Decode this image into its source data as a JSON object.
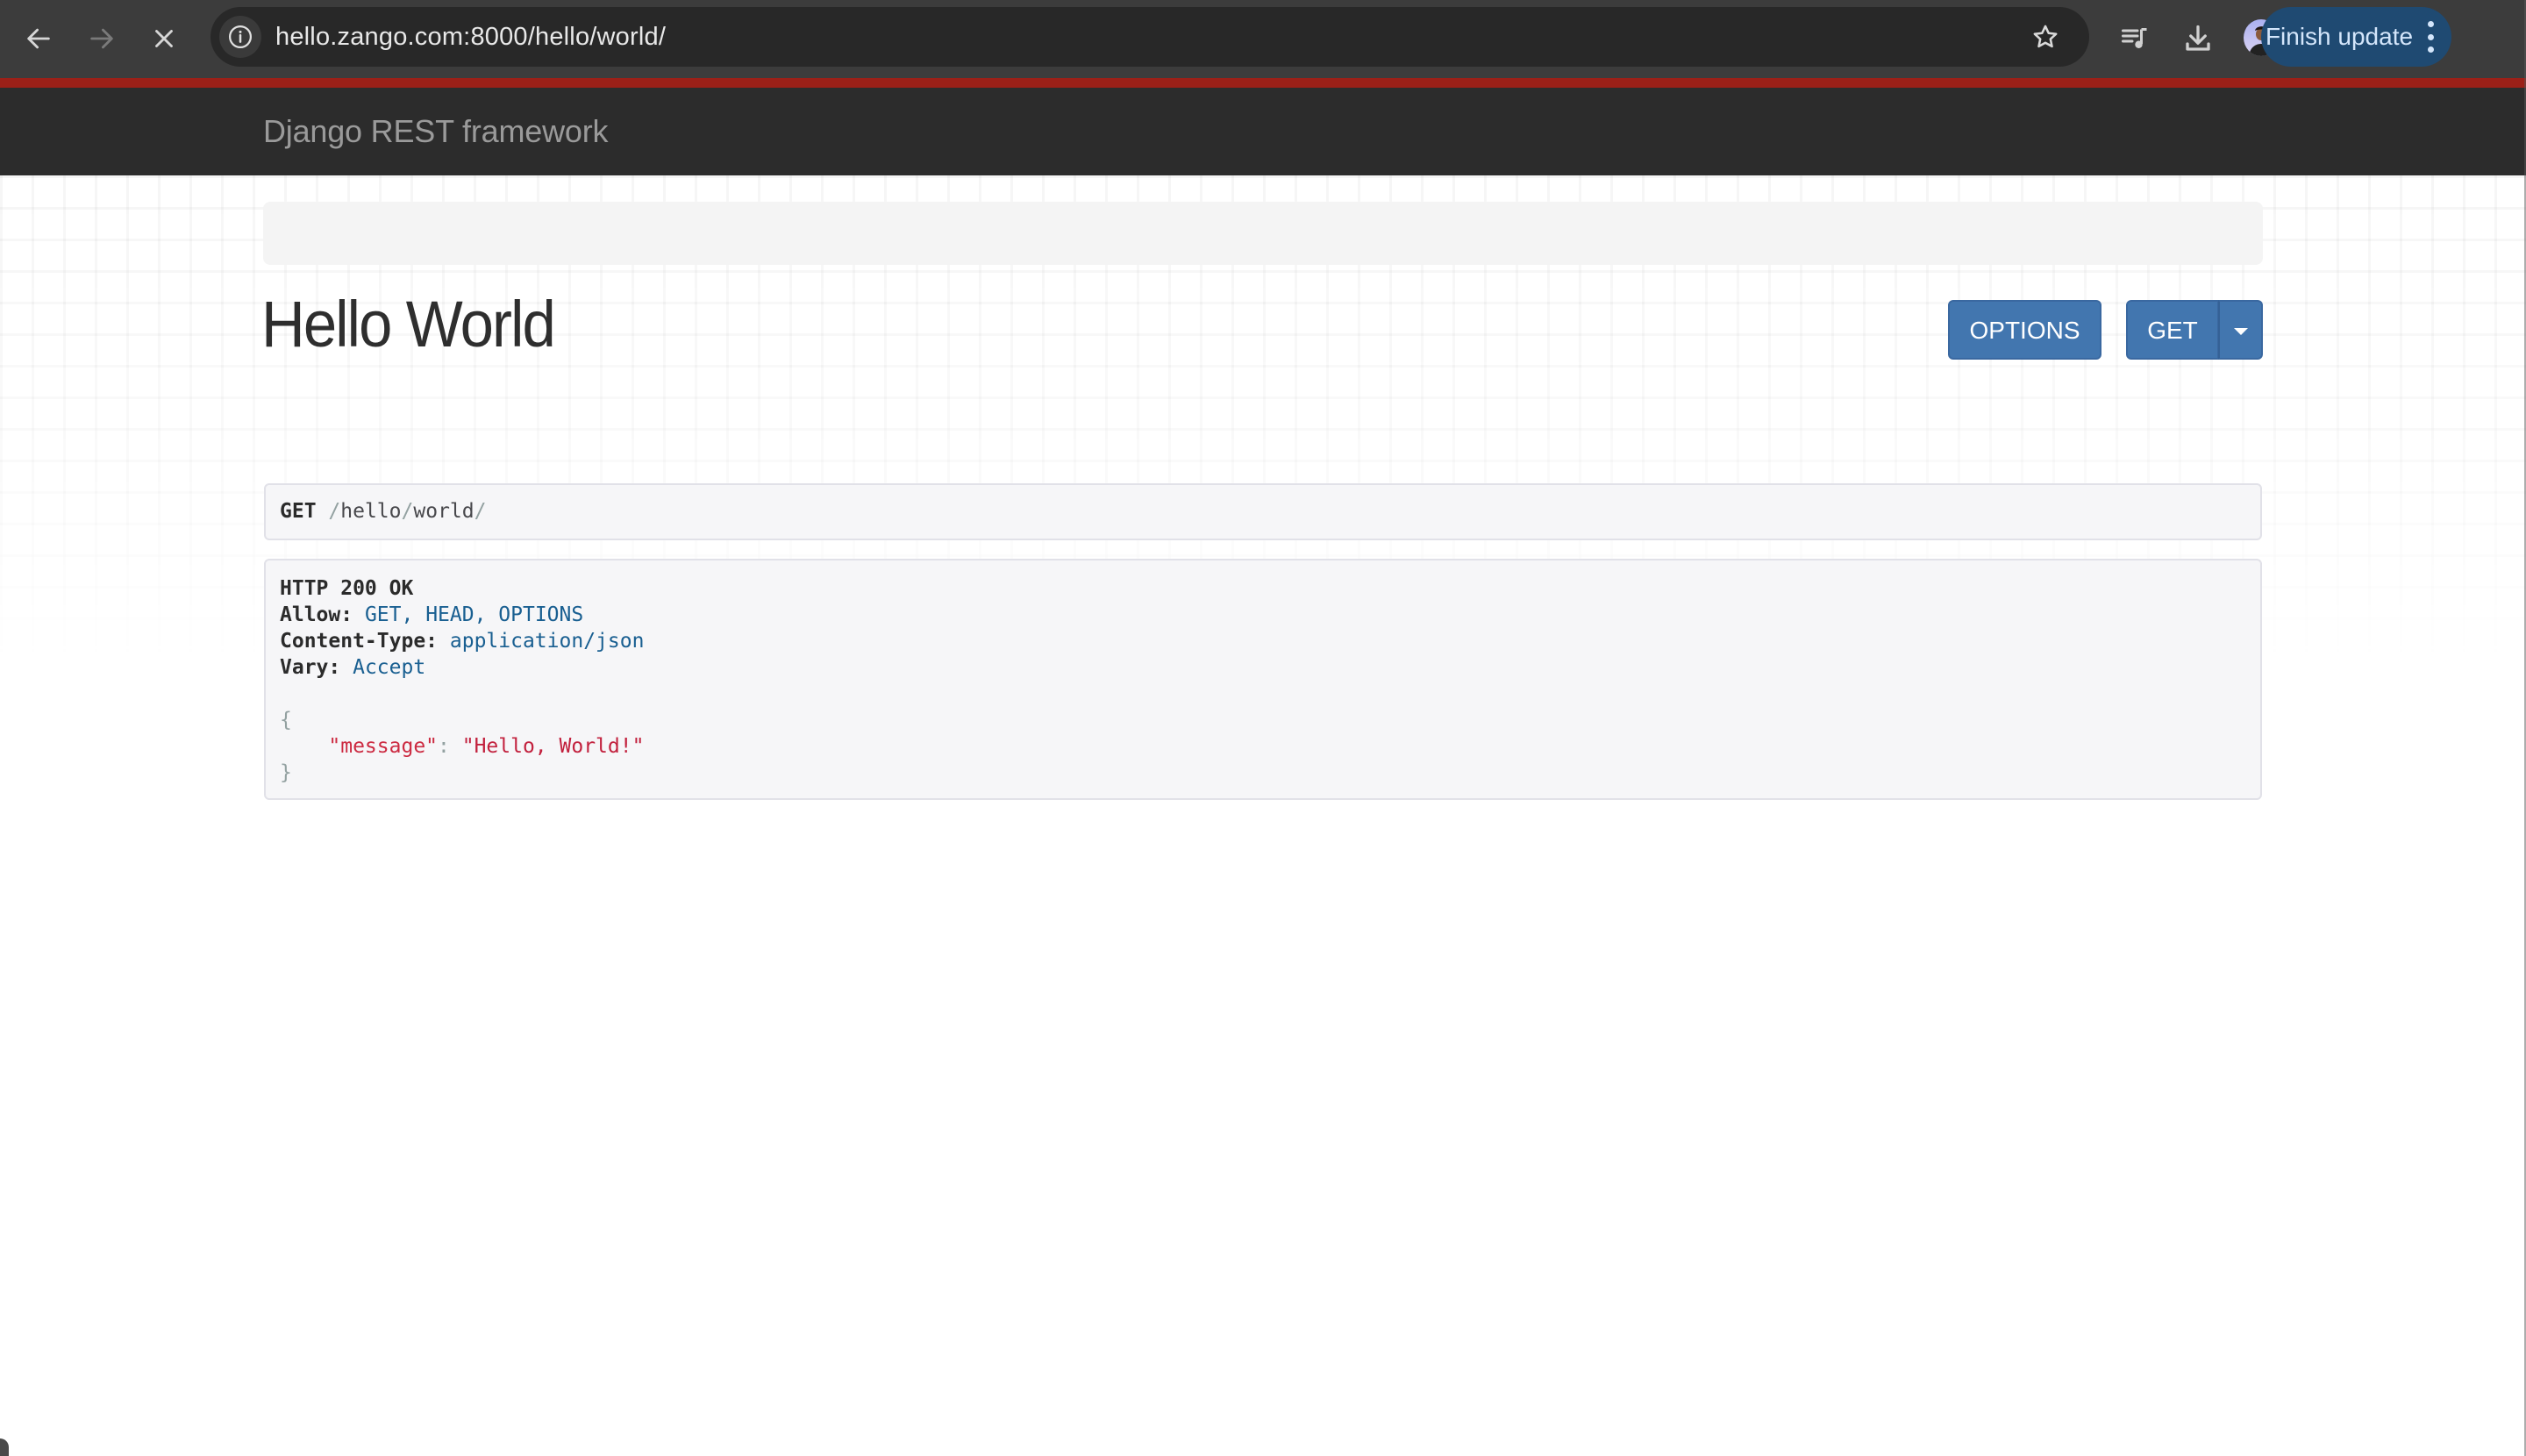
{
  "browser": {
    "url": "hello.zango.com:8000/hello/world/",
    "update_button_label": "Finish update",
    "icons": {
      "back": "arrow-left-icon",
      "forward": "arrow-right-icon",
      "stop": "close-icon",
      "site_info": "info-icon",
      "bookmark": "star-icon",
      "media": "queue-music-icon",
      "downloads": "download-icon",
      "profile": "avatar",
      "menu": "kebab-menu-icon"
    }
  },
  "navbar": {
    "brand": "Django REST framework",
    "accent_color": "#9b2018"
  },
  "page": {
    "title": "Hello World",
    "buttons": {
      "options": "OPTIONS",
      "get": "GET"
    },
    "request": {
      "method": "GET",
      "path_segments": [
        "/",
        "hello",
        "/",
        "world",
        "/"
      ]
    },
    "response": {
      "status_line": "HTTP 200 OK",
      "headers": [
        {
          "name": "Allow:",
          "value": "GET, HEAD, OPTIONS"
        },
        {
          "name": "Content-Type:",
          "value": "application/json"
        },
        {
          "name": "Vary:",
          "value": "Accept"
        }
      ],
      "body": {
        "open_brace": "{",
        "key": "\"message\"",
        "colon": ": ",
        "value": "\"Hello, World!\"",
        "close_brace": "}"
      }
    }
  }
}
